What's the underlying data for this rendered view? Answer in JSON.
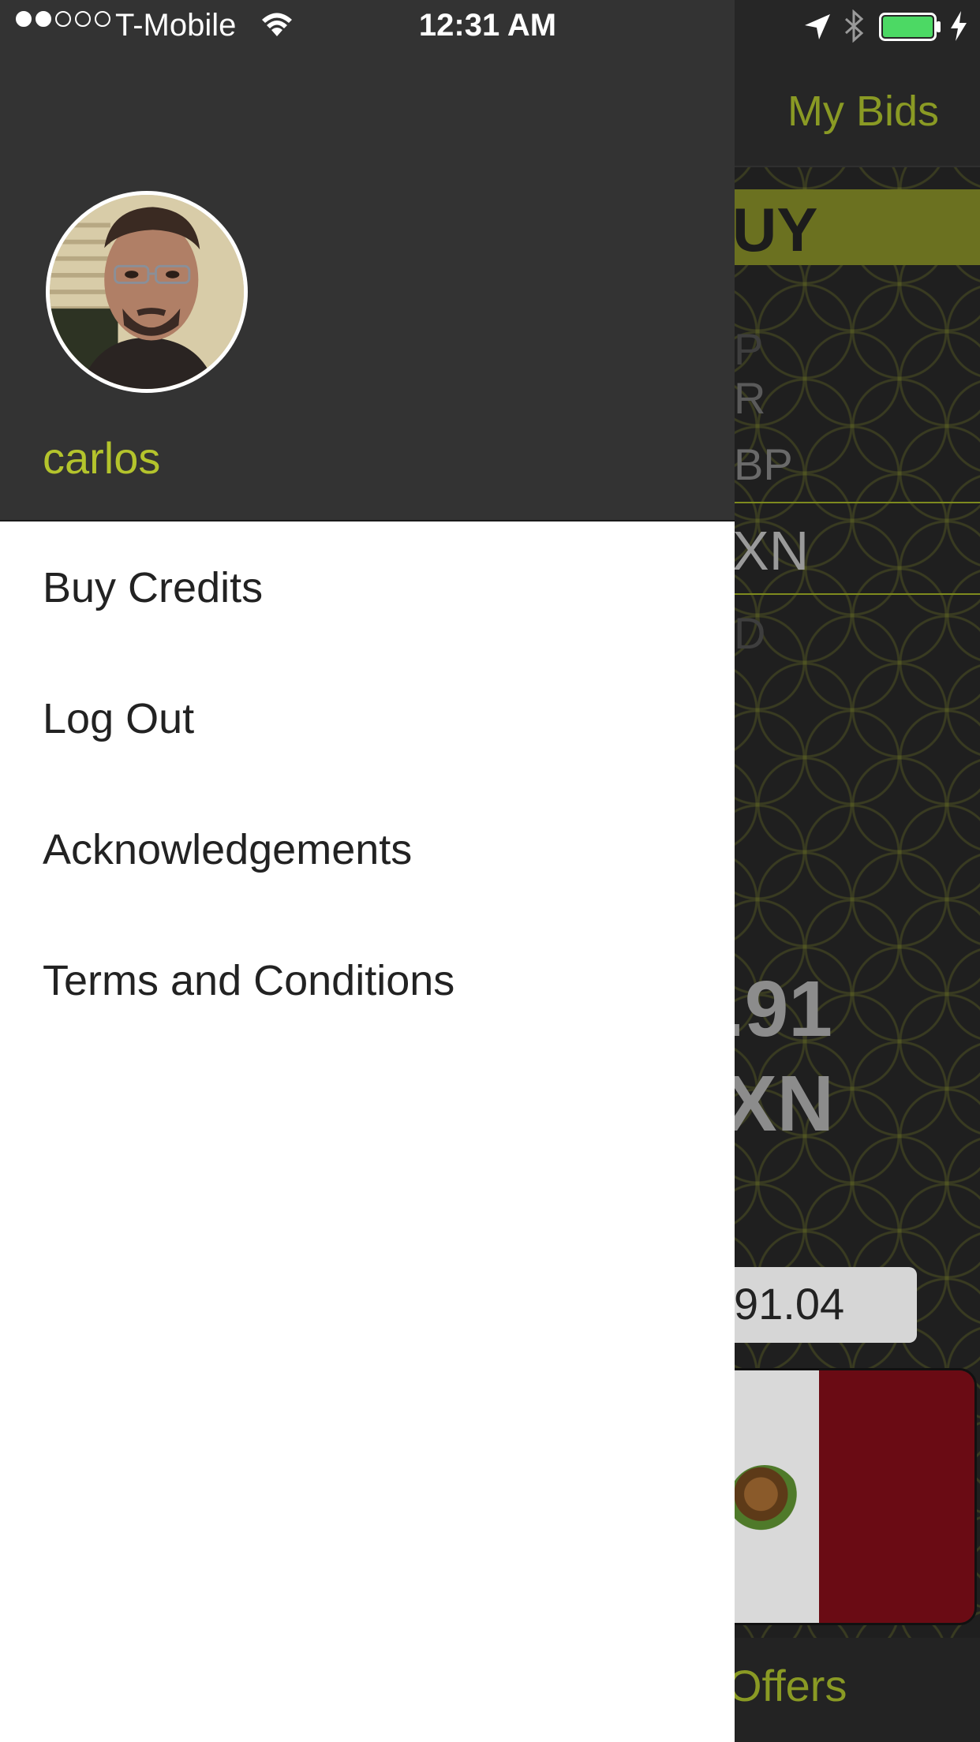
{
  "status_bar": {
    "carrier": "T-Mobile",
    "time": "12:31 AM",
    "signal_bars_filled": 2,
    "signal_bars_total": 5,
    "battery_level": 1.0,
    "icons": [
      "wifi-icon",
      "location-icon",
      "bluetooth-icon",
      "battery-icon",
      "charging-icon"
    ]
  },
  "drawer": {
    "username": "carlos",
    "avatar_icon": "user-photo",
    "menu": [
      {
        "label": "Buy Credits"
      },
      {
        "label": "Log Out"
      },
      {
        "label": "Acknowledgements"
      },
      {
        "label": "Terms and Conditions"
      }
    ]
  },
  "background_app": {
    "nav_right": "My Bids",
    "banner_fragment": "UY",
    "currency_fragments": [
      "P",
      "R",
      "BP",
      "XN",
      "D"
    ],
    "rate_fragment": ".91",
    "rate_unit_fragment": "XN",
    "amount_fragment": "91.04",
    "tab_fragment": "Offers"
  },
  "colors": {
    "accent": "#b4c42c",
    "drawer_header": "#333333",
    "drawer_body": "#ffffff",
    "background": "#1f1f1f",
    "banner": "#6b7120"
  }
}
